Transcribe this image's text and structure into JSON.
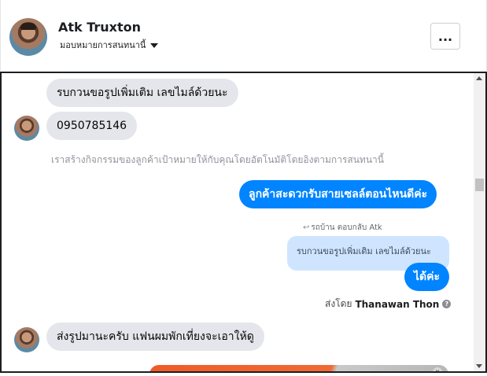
{
  "header": {
    "name": "Atk Truxton",
    "assign_label": "มอบหมายการสนทนานี้",
    "more_label": "..."
  },
  "messages": {
    "incoming_1": "รบกวนขอรูปเพิ่มเติม เลขไมล์ด้วยนะ",
    "incoming_2": "0950785146",
    "system_note": "เราสร้างกิจกรรมของลูกค้าเป้าหมายให้กับคุณโดยอัตโนมัติโดยอิงตามการสนทนานี้",
    "outgoing_1": "ลูกค้าสะดวกรับสายเซลล์ตอนไหนดีค่ะ",
    "reply_meta": "รถบ้าน ตอบกลับ Atk",
    "quoted_text": "รบกวนขอรูปเพิ่มเติม เลขไมล์ด้วยนะ",
    "outgoing_2": "ได้ค่ะ",
    "sent_by_label": "ส่งโดย",
    "sent_by_agent": "Thanawan Thon",
    "incoming_3": "ส่งรูปมานะครับ แฟนผมพักเที่ยงจะเอาให้ดู"
  },
  "colors": {
    "outgoing_bubble": "#0084ff",
    "incoming_bubble": "#e4e6eb",
    "quoted_bubble": "#cfe5ff"
  },
  "icons": {
    "caret": "chevron-down-icon",
    "reply": "reply-arrow-icon",
    "help": "help-icon"
  }
}
